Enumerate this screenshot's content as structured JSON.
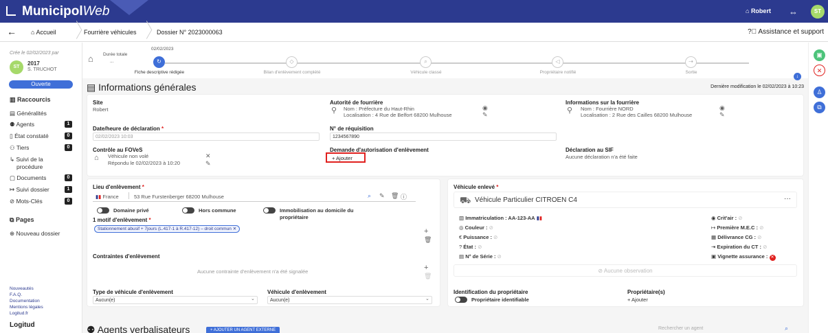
{
  "topbar": {
    "brand_main": "Municipol",
    "brand_web": "Web",
    "user": "Robert",
    "avatar": "ST"
  },
  "crumbs": {
    "back": "←",
    "home": "Accueil",
    "c1": "Fourrière véhicules",
    "c2": "Dossier N° 2023000063",
    "help": "Assistance et support"
  },
  "sidebar": {
    "created": "Crée le 02/02/2023 par",
    "year": "2017",
    "user": "S. TRUCHOT",
    "avatar": "ST",
    "status": "Ouverte",
    "shortcuts": "Raccourcis",
    "items": [
      {
        "label": "Généralités",
        "count": ""
      },
      {
        "label": "Agents",
        "count": "1"
      },
      {
        "label": "État constaté",
        "count": "0"
      },
      {
        "label": "Tiers",
        "count": "0"
      },
      {
        "label": "Suivi de la",
        "count": ""
      },
      {
        "label": "procédure",
        "count": ""
      },
      {
        "label": "Documents",
        "count": "0"
      },
      {
        "label": "Suivi dossier",
        "count": "1"
      },
      {
        "label": "Mots-Clés",
        "count": "0"
      }
    ],
    "pages": "Pages",
    "new_file": "Nouveau dossier",
    "links": [
      "Nouveautés",
      "F.A.Q.",
      "Documentation",
      "Mentions légales",
      "Logitud.fr"
    ],
    "footer_logo": "Logitud"
  },
  "progress": {
    "duration_label": "Durée totale",
    "duration_value": "...",
    "date": "02/02/2023",
    "steps": [
      "Fiche descriptive rédigée",
      "Bilan d'enlèvement complété",
      "Véhicule classé",
      "Propriétaire notifié",
      "Sortie"
    ]
  },
  "info": {
    "title": "Informations générales",
    "last_mod": "Dernière modification le 02/02/2023 à 10:23",
    "site_lbl": "Site",
    "site_val": "Robert",
    "auth_lbl": "Autorité de fourrière",
    "auth_name": "Nom : Préfecture du Haut-Rhin",
    "auth_loc": "Localisation : 4 Rue de Belfort 68200 Mulhouse",
    "fourr_lbl": "Informations sur la fourrière",
    "fourr_name": "Nom : Fourrière NORD",
    "fourr_loc": "Localisation : 2 Rue des Cailles 68200 Mulhouse",
    "decl_lbl": "Date/heure de déclaration",
    "decl_val": "02/02/2023 10:03",
    "req_lbl": "N° de réquisition",
    "req_val": "1234567890",
    "fov_lbl": "Contrôle au FOVeS",
    "fov_val1": "Véhicule non volé",
    "fov_val2": "Répondu le 02/02/2023 à 10:20",
    "dem_lbl": "Demande d'autorisation d'enlèvement",
    "dem_add": "+ Ajouter",
    "sif_lbl": "Déclaration au SIF",
    "sif_val": "Aucune déclaration n'a été faite"
  },
  "lieu": {
    "title": "Lieu d'enlèvement",
    "country": "France",
    "address": "53 Rue Furstenberger 68200 Mulhouse",
    "t1": "Domaine privé",
    "t2": "Hors commune",
    "t3": "Immobilisation au domicile du",
    "t3b": "propriétaire",
    "motif_lbl": "1 motif d'enlèvement",
    "motif_chip": "Stationnement abusif + 7jours (L.417-1 à R.417-12) – droit commun",
    "contr_lbl": "Contraintes d'enlèvement",
    "contr_empty": "Aucune contrainte d'enlèvement n'a été signalée",
    "type_lbl": "Type de véhicule d'enlèvement",
    "type_val": "Aucun(e)",
    "veh_lbl": "Véhicule d'enlèvement",
    "veh_val": "Aucun(e)"
  },
  "vehicle": {
    "title": "Véhicule enlevé",
    "name": "Véhicule Particulier CITROEN C4",
    "more": "···",
    "immat": "Immatriculation : AA-123-AA",
    "couleur": "Couleur :",
    "puissance": "Puissance :",
    "etat": "État :",
    "serie": "N° de Série :",
    "critair": "Crit'air :",
    "mec": "Première M.E.C :",
    "cg": "Délivrance CG :",
    "ct": "Expiration du CT :",
    "vignette": "Vignette assurance :",
    "no_obs": "Aucune observation",
    "ident_lbl": "Identification du propriétaire",
    "ident_toggle": "Propriétaire identifiable",
    "prop_lbl": "Propriétaire(s)",
    "prop_add": "+ Ajouter"
  },
  "agents": {
    "title": "Agents verbalisateurs",
    "btn": "+ AJOUTER UN AGENT EXTERNE",
    "search": "Rechercher un agent"
  }
}
